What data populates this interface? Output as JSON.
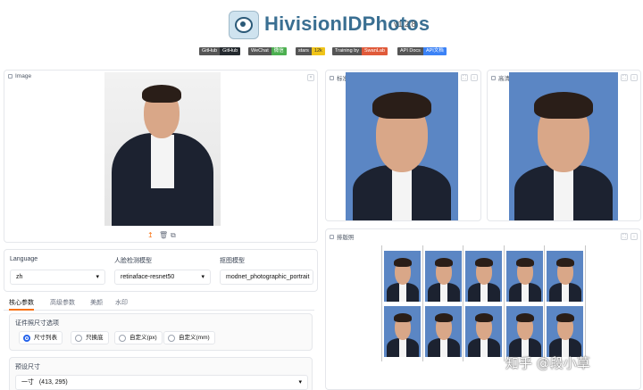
{
  "header": {
    "title": "HivisionIDPhotos",
    "version": "v1.2.8",
    "badges": [
      {
        "left": "GitHub",
        "right": "GitHub",
        "color": "#24292e"
      },
      {
        "left": "WeChat",
        "right": "微信",
        "color": "#4caf50"
      },
      {
        "left": "stars",
        "right": "12k",
        "color": "#f0c419"
      },
      {
        "left": "Training by",
        "right": "SwanLab",
        "color": "#e05a3a"
      },
      {
        "left": "API Docs",
        "right": "API文档",
        "color": "#3b82f6"
      }
    ]
  },
  "input_panel": {
    "label": "Image"
  },
  "image_actions": {
    "upload": "↥",
    "delete": "🗑",
    "webcam": "⧉"
  },
  "standard_panel": {
    "label": "标准照"
  },
  "hd_panel": {
    "label": "高清照"
  },
  "layout_panel": {
    "label": "排版照"
  },
  "settings": {
    "language": {
      "label": "Language",
      "value": "zh"
    },
    "face_detect": {
      "label": "人脸检测模型",
      "value": "retinaface-resnet50"
    },
    "matting": {
      "label": "抠图模型",
      "value": "modnet_photographic_portrait"
    }
  },
  "tabs": [
    "核心参数",
    "高级参数",
    "美颜",
    "水印"
  ],
  "size_options": {
    "label": "证件照尺寸选项",
    "options": [
      "尺寸列表",
      "只换底",
      "自定义(px)",
      "自定义(mm)"
    ],
    "selected": "尺寸列表"
  },
  "preset": {
    "label": "预设尺寸",
    "value": "一寸",
    "dims": "(413, 295)"
  },
  "watermark": "知乎 @段小草",
  "colors": {
    "photo_bg": "#5b86c4",
    "accent": "#f97316",
    "radio": "#2563eb"
  }
}
